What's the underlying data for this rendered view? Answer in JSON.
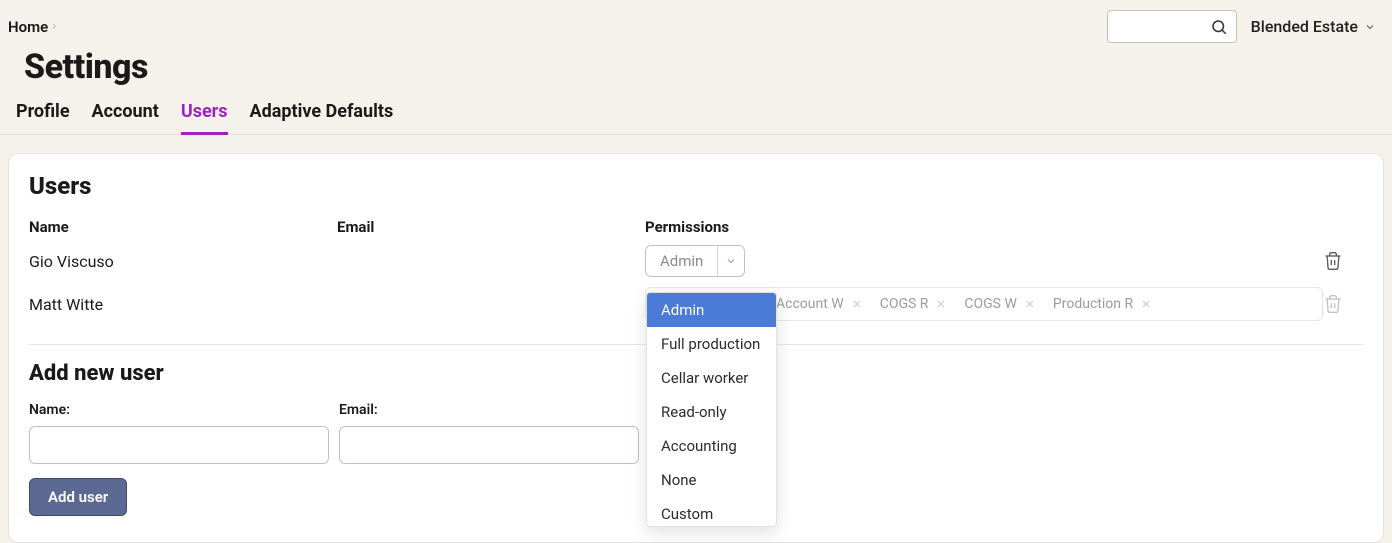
{
  "breadcrumb": {
    "home": "Home"
  },
  "org": {
    "name": "Blended Estate"
  },
  "page_title": "Settings",
  "tabs": {
    "profile": "Profile",
    "account": "Account",
    "users": "Users",
    "adaptive_defaults": "Adaptive Defaults",
    "active": "users"
  },
  "users_section": {
    "title": "Users",
    "columns": {
      "name": "Name",
      "email": "Email",
      "permissions": "Permissions"
    },
    "rows": [
      {
        "name": "Gio Viscuso",
        "email": "",
        "perm_selected": "Admin"
      },
      {
        "name": "Matt Witte",
        "email": "",
        "perm_tags": [
          "Account W",
          "COGS R",
          "COGS W",
          "Production R"
        ]
      }
    ],
    "perm_options": [
      "Admin",
      "Full production",
      "Cellar worker",
      "Read-only",
      "Accounting",
      "None",
      "Custom"
    ]
  },
  "add_user": {
    "title": "Add new user",
    "name_label": "Name:",
    "email_label": "Email:",
    "name_value": "",
    "email_value": "",
    "button": "Add user"
  }
}
